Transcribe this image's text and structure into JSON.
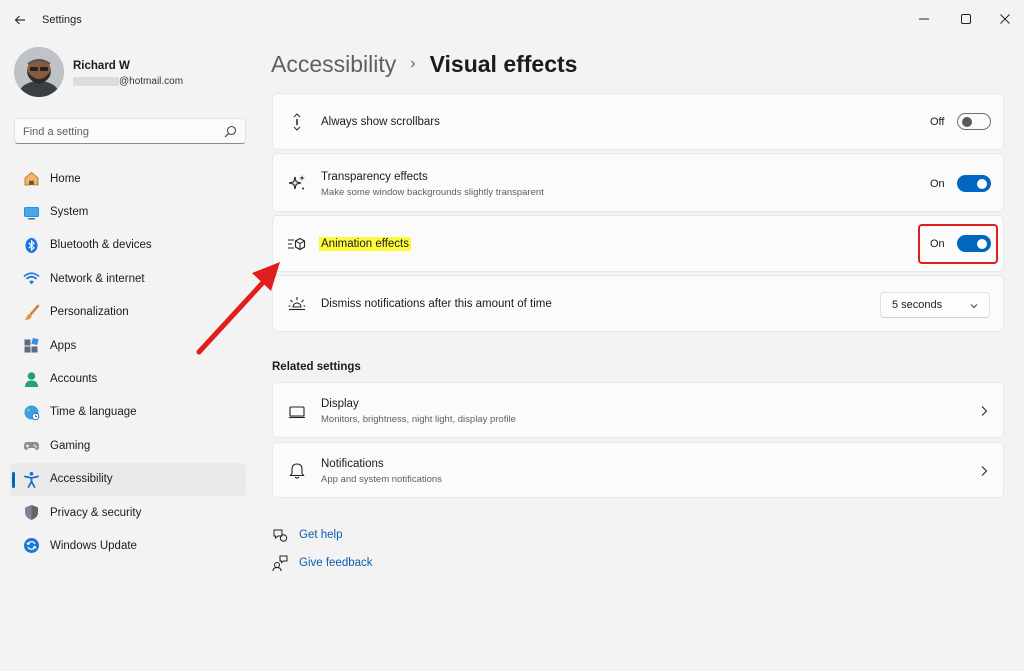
{
  "window": {
    "title": "Settings",
    "icons": {
      "back": "back-arrow-icon",
      "minimize": "minimize-icon",
      "maximize": "maximize-icon",
      "close": "close-icon"
    }
  },
  "profile": {
    "name": "Richard W",
    "email_suffix": "@hotmail.com"
  },
  "search": {
    "placeholder": "Find a setting"
  },
  "sidebar": {
    "items": [
      {
        "label": "Home",
        "icon": "home-icon"
      },
      {
        "label": "System",
        "icon": "system-icon"
      },
      {
        "label": "Bluetooth & devices",
        "icon": "bluetooth-icon"
      },
      {
        "label": "Network & internet",
        "icon": "network-icon"
      },
      {
        "label": "Personalization",
        "icon": "brush-icon"
      },
      {
        "label": "Apps",
        "icon": "apps-icon"
      },
      {
        "label": "Accounts",
        "icon": "accounts-icon"
      },
      {
        "label": "Time & language",
        "icon": "globe-icon"
      },
      {
        "label": "Gaming",
        "icon": "gamepad-icon"
      },
      {
        "label": "Accessibility",
        "icon": "accessibility-icon",
        "active": true
      },
      {
        "label": "Privacy & security",
        "icon": "shield-icon"
      },
      {
        "label": "Windows Update",
        "icon": "update-icon"
      }
    ]
  },
  "breadcrumb": {
    "parent": "Accessibility",
    "separator": "›",
    "current": "Visual effects"
  },
  "settings": {
    "scrollbars": {
      "title": "Always show scrollbars",
      "state": "Off",
      "icon": "scrollbar-icon"
    },
    "transparency": {
      "title": "Transparency effects",
      "subtitle": "Make some window backgrounds slightly transparent",
      "state": "On",
      "icon": "sparkle-icon"
    },
    "animation": {
      "title": "Animation effects",
      "state": "On",
      "icon": "animation-icon"
    },
    "notifications_timeout": {
      "title": "Dismiss notifications after this amount of time",
      "value": "5 seconds",
      "icon": "sun-icon"
    }
  },
  "related": {
    "title": "Related settings",
    "display": {
      "title": "Display",
      "subtitle": "Monitors, brightness, night light, display profile",
      "icon": "monitor-icon"
    },
    "notifications": {
      "title": "Notifications",
      "subtitle": "App and system notifications",
      "icon": "bell-icon"
    }
  },
  "help": {
    "get_help": "Get help",
    "give_feedback": "Give feedback"
  },
  "colors": {
    "accent": "#0067c0",
    "highlight": "#fbfb3c",
    "annotation": "#e02020"
  }
}
